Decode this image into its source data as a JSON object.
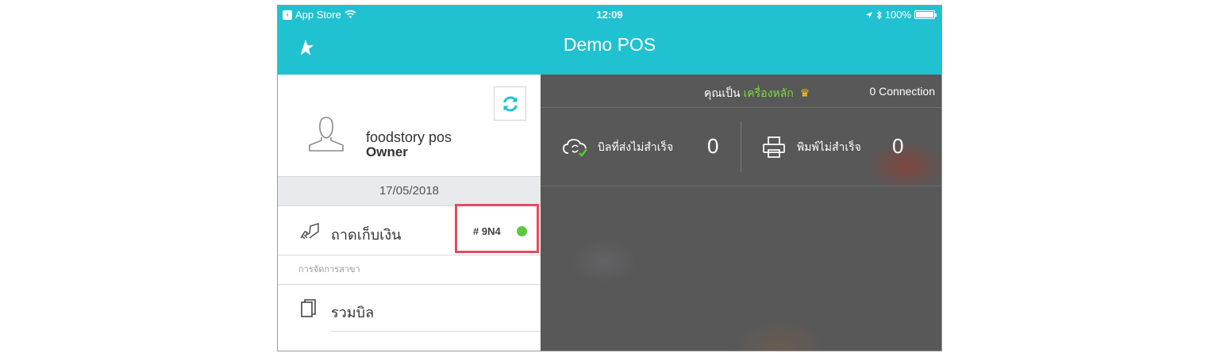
{
  "status_bar": {
    "carrier": "App Store",
    "time": "12:09",
    "battery": "100%"
  },
  "header": {
    "title": "Demo POS"
  },
  "profile": {
    "name": "foodstory pos",
    "role": "Owner"
  },
  "date": "17/05/2018",
  "cash_drawer": {
    "label": "ถาดเก็บเงิน",
    "code": "# 9N4",
    "status_color": "#5cc83d"
  },
  "branch_section": {
    "title": "การจัดการสาขา"
  },
  "menu": [
    {
      "label": "รวมบิล",
      "icon": "bills-icon"
    }
  ],
  "main_panel": {
    "role_prefix": "คุณเป็น",
    "role_value": "เครื่องหลัก",
    "connections": "0 Connection",
    "unsent_bills_label": "บิลที่ส่งไม่สำเร็จ",
    "unsent_bills_count": "0",
    "failed_prints_label": "พิมพ์ไม่สำเร็จ",
    "failed_prints_count": "0"
  },
  "colors": {
    "accent": "#20c1d1",
    "highlight": "#e84a5f",
    "role_green": "#78df3a",
    "crown": "#f5c518"
  }
}
